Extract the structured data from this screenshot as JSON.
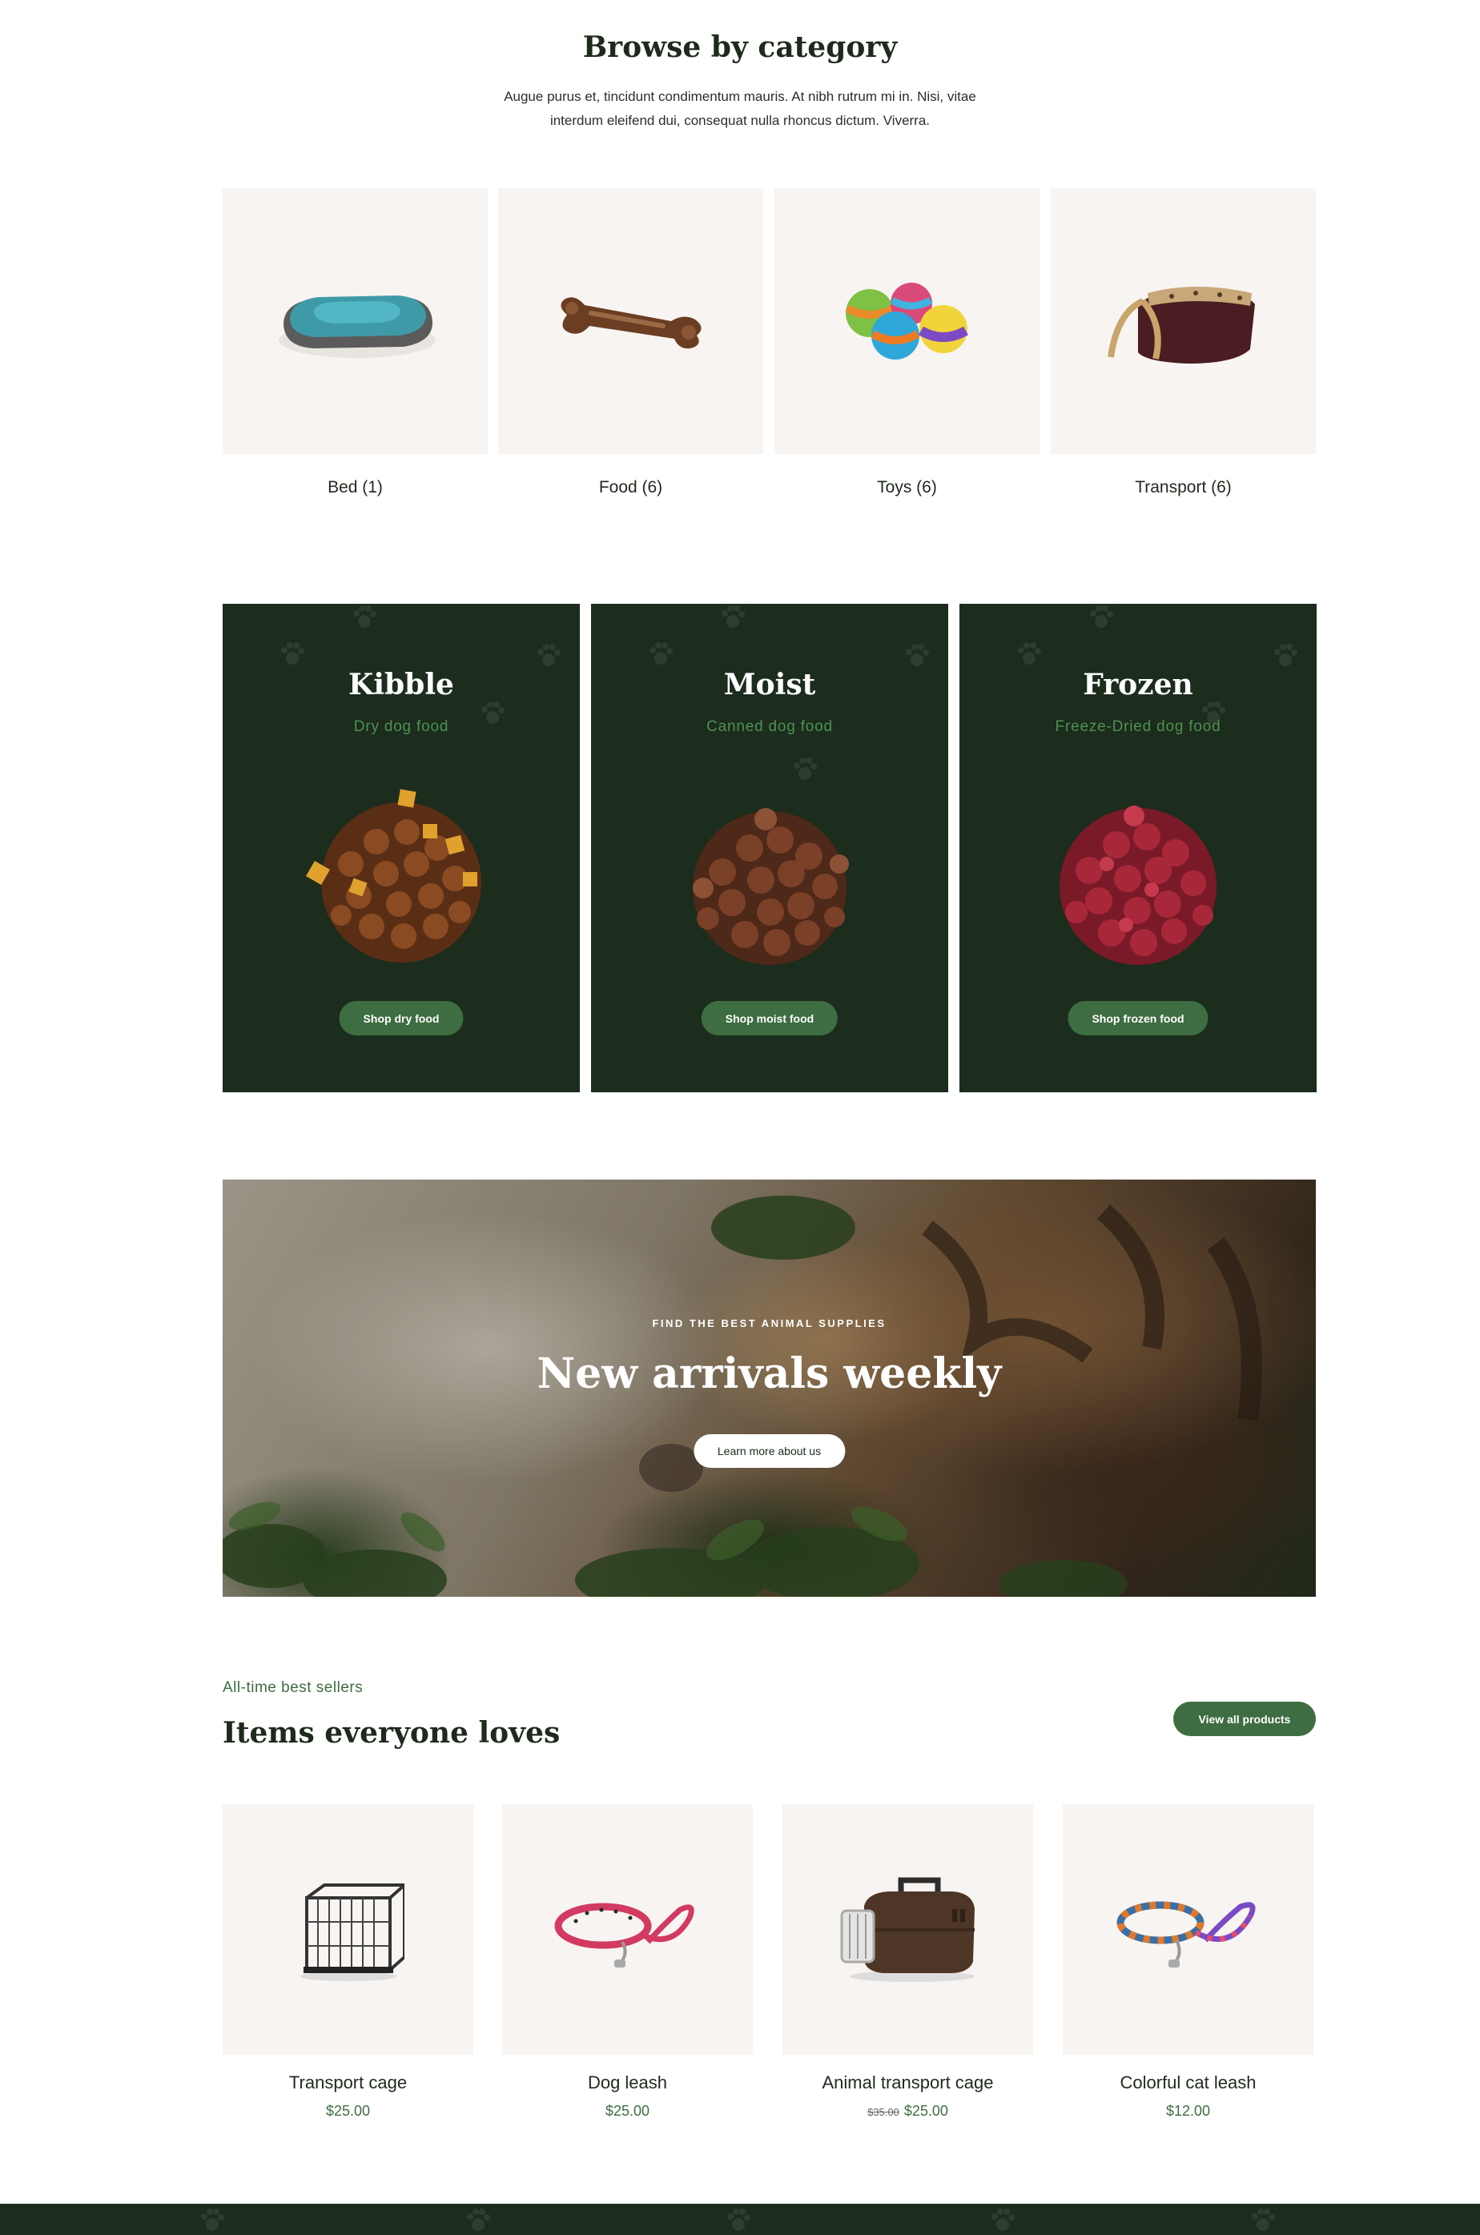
{
  "categories_section": {
    "heading": "Browse by category",
    "intro": "Augue purus et, tincidunt condimentum mauris. At nibh rutrum mi in. Nisi, vitae interdum eleifend dui, consequat nulla rhoncus dictum. Viverra.",
    "items": [
      {
        "label": "Bed (1)",
        "icon": "pet-bed-icon"
      },
      {
        "label": "Food (6)",
        "icon": "bone-icon"
      },
      {
        "label": "Toys (6)",
        "icon": "toy-balls-icon"
      },
      {
        "label": "Transport (6)",
        "icon": "pet-carrier-bag-icon"
      }
    ]
  },
  "food_panels": [
    {
      "title": "Kibble",
      "subtitle": "Dry dog food",
      "button": "Shop dry food",
      "pile_color": "#8a4b22",
      "accent": "#e0a12d"
    },
    {
      "title": "Moist",
      "subtitle": "Canned dog food",
      "button": "Shop moist food",
      "pile_color": "#7a4028",
      "accent": "#8d5235"
    },
    {
      "title": "Frozen",
      "subtitle": "Freeze-Dried dog food",
      "button": "Shop frozen food",
      "pile_color": "#a8283a",
      "accent": "#c53a4c"
    }
  ],
  "hero": {
    "eyebrow": "FIND THE BEST ANIMAL SUPPLIES",
    "title": "New arrivals weekly",
    "button": "Learn more about us"
  },
  "best_sellers": {
    "eyebrow": "All-time best sellers",
    "title": "Items everyone loves",
    "view_all": "View all products",
    "products": [
      {
        "name": "Transport cage",
        "price": "$25.00",
        "old_price": "",
        "icon": "wire-cage-icon"
      },
      {
        "name": "Dog leash",
        "price": "$25.00",
        "old_price": "",
        "icon": "red-leash-icon"
      },
      {
        "name": "Animal transport cage",
        "price": "$25.00",
        "old_price": "$35.00",
        "icon": "plastic-carrier-icon"
      },
      {
        "name": "Colorful cat leash",
        "price": "$12.00",
        "old_price": "",
        "icon": "striped-leash-icon"
      }
    ]
  },
  "colors": {
    "dark_green": "#1c2c1d",
    "accent_green": "#3d6d41",
    "card_bg": "#f8f4f1"
  }
}
